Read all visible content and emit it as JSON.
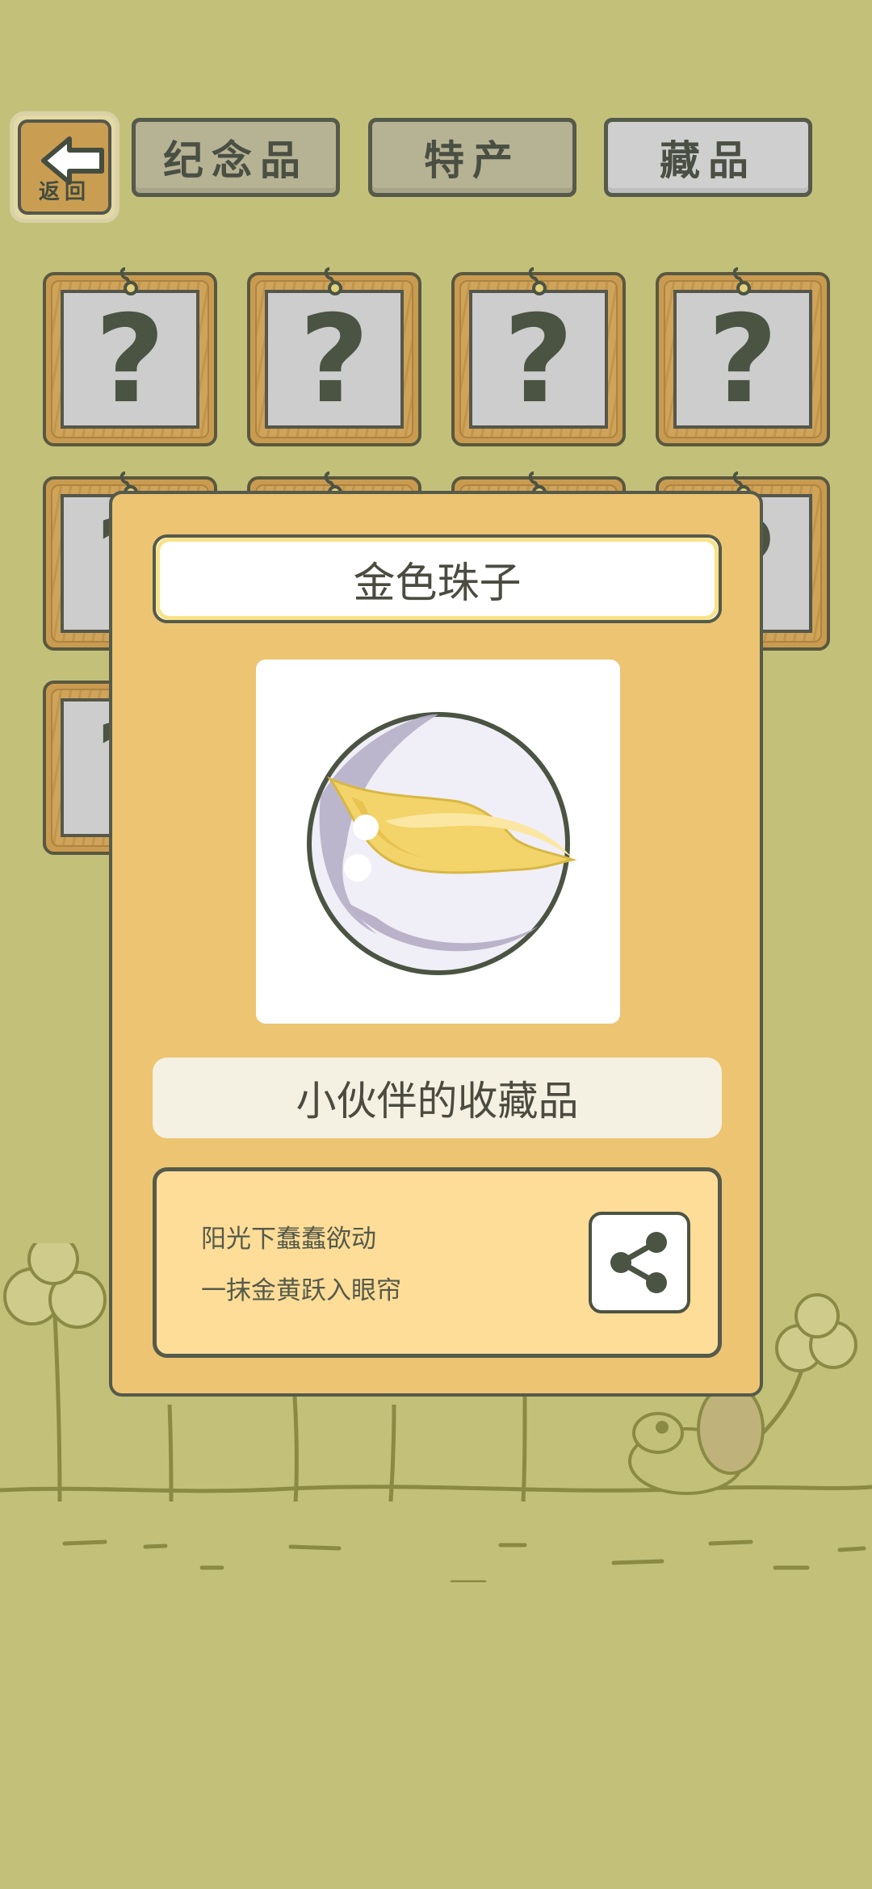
{
  "header": {
    "back_label": "返回",
    "tabs": [
      {
        "label": "纪念品",
        "active": false
      },
      {
        "label": "特产",
        "active": false
      },
      {
        "label": "藏品",
        "active": true
      }
    ]
  },
  "grid": {
    "slots": [
      {
        "label": "?"
      },
      {
        "label": "?"
      },
      {
        "label": "?"
      },
      {
        "label": "?"
      },
      {
        "label": "?"
      },
      {
        "label": "?"
      },
      {
        "label": "?"
      },
      {
        "label": "?"
      },
      {
        "label": "?"
      }
    ]
  },
  "dialog": {
    "item_name": "金色珠子",
    "item_icon": "golden-marble",
    "category": "小伙伴的收藏品",
    "description_lines": [
      "阳光下蠢蠢欲动",
      "一抹金黄跃入眼帘"
    ],
    "share_icon": "share-icon"
  },
  "colors": {
    "background": "#c3c07a",
    "dialog": "#ecc472",
    "desc_box": "#fedd98",
    "outline": "#555a4a"
  }
}
